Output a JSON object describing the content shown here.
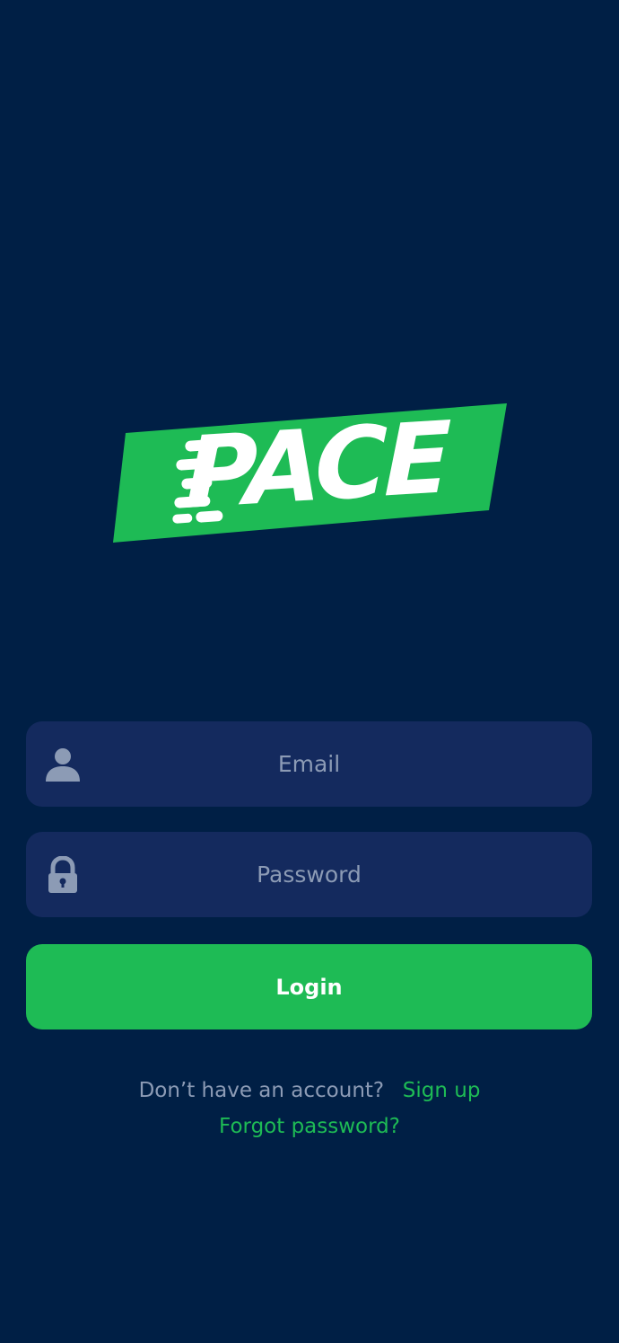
{
  "logo": {
    "text": "PACE",
    "band_color": "#1ebb55",
    "text_color": "#ffffff"
  },
  "login_form": {
    "email": {
      "placeholder": "Email",
      "value": "",
      "icon": "user-icon"
    },
    "password": {
      "placeholder": "Password",
      "value": "",
      "icon": "lock-icon"
    },
    "login_label": "Login"
  },
  "footer": {
    "signup_prompt": "Don’t have an account?",
    "signup_link": "Sign up",
    "forgot_link": "Forgot password?"
  },
  "colors": {
    "background": "#001f45",
    "field": "#142a5e",
    "accent": "#1ebb55",
    "muted_text": "#8c9bb5"
  }
}
